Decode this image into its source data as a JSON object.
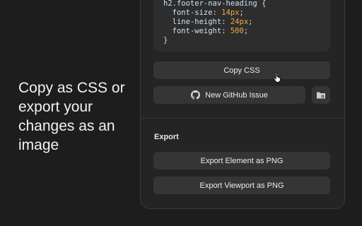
{
  "tagline": "Copy as CSS or export your changes as an image",
  "code": {
    "selector": "h2.footer-nav-heading",
    "props": [
      {
        "name": "font-size",
        "value": "14px"
      },
      {
        "name": "line-height",
        "value": "24px"
      },
      {
        "name": "font-weight",
        "value": "500"
      }
    ],
    "close": "}"
  },
  "buttons": {
    "copy_css": "Copy CSS",
    "github_issue": "New GitHub Issue",
    "export_element": "Export Element as PNG",
    "export_viewport": "Export Viewport as PNG"
  },
  "export_heading": "Export",
  "icons": {
    "github": "github-icon",
    "folder": "folder-icon",
    "cursor": "pointer-hand-icon"
  },
  "colors": {
    "background": "#1d1d1d",
    "panel": "#242424",
    "button": "#353535",
    "code_value": "#f0a84a"
  }
}
